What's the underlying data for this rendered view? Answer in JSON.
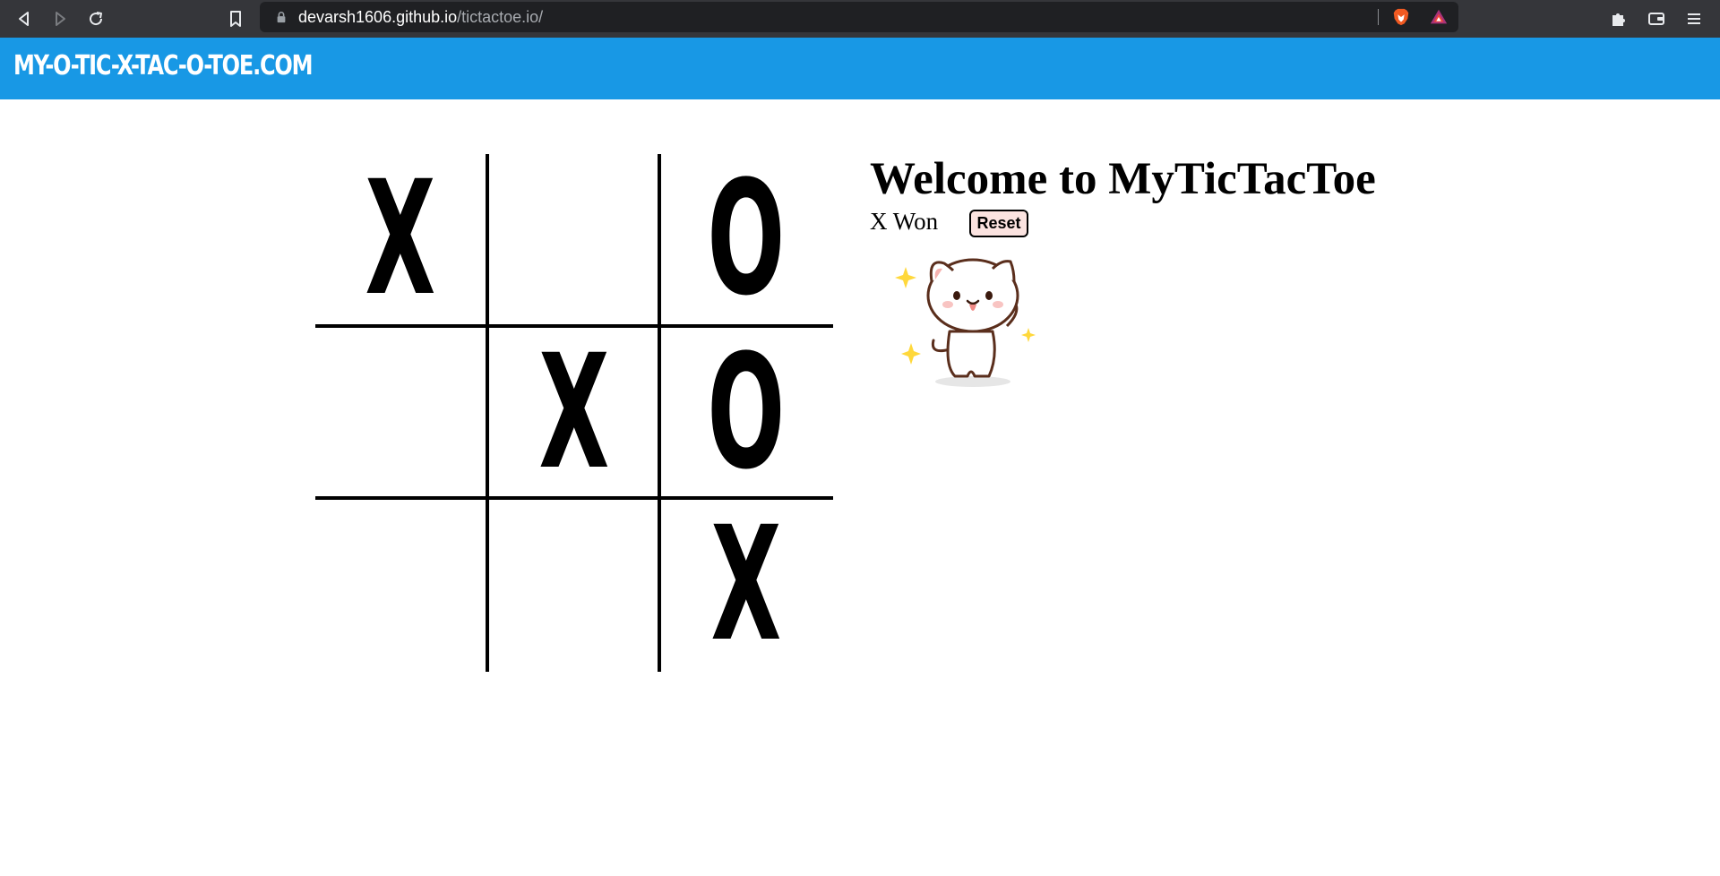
{
  "browser": {
    "url_host": "devarsh1606.github.io",
    "url_path": "/tictactoe.io/"
  },
  "header": {
    "logo": "MY-O-TIC-X-TAC-O-TOE.COM",
    "background": "#1898e5"
  },
  "board": {
    "cells": [
      "X",
      "",
      "O",
      "",
      "X",
      "O",
      "",
      "",
      "X"
    ]
  },
  "panel": {
    "title": "Welcome to MyTicTacToe",
    "status": "X Won",
    "reset_label": "Reset",
    "reset_color": "#fbe3e0"
  },
  "icons": {
    "back": "back-arrow-icon",
    "forward": "forward-arrow-icon",
    "reload": "reload-icon",
    "bookmark": "bookmark-icon",
    "lock": "lock-icon",
    "brave": "brave-lion-icon",
    "rewards": "brave-rewards-icon",
    "extensions": "puzzle-icon",
    "wallet": "wallet-icon",
    "menu": "hamburger-menu-icon",
    "cat": "dancing-cat-sticker"
  }
}
